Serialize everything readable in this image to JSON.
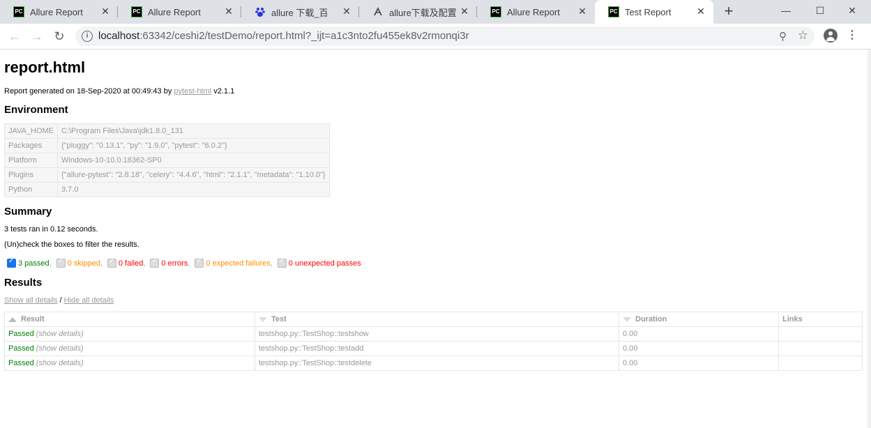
{
  "browser": {
    "tabs": [
      {
        "title": "Allure Report",
        "icon": "pycharm-icon"
      },
      {
        "title": "Allure Report",
        "icon": "pycharm-icon"
      },
      {
        "title": "allure 下载_百度搜索",
        "icon": "baidu-paw-icon"
      },
      {
        "title": "allure下载及配置 -",
        "icon": "refresh-doc-icon"
      },
      {
        "title": "Allure Report",
        "icon": "pycharm-icon"
      },
      {
        "title": "Test Report",
        "icon": "pycharm-icon"
      }
    ],
    "tab_icon_text": "PC",
    "close_glyph": "✕",
    "new_tab_glyph": "+",
    "window": {
      "minimize": "—",
      "maximize": "☐",
      "close": "✕"
    },
    "url_host": "localhost",
    "url_rest": ":63342/ceshi2/testDemo/report.html?_ijt=a1c3nto2fu455ek8v2rmonqi3r",
    "nav": {
      "back": "←",
      "forward": "→",
      "reload": "↻"
    },
    "info_glyph": "i",
    "zoom_glyph": "⚲",
    "star_glyph": "☆",
    "menu_glyph": "⋮"
  },
  "report": {
    "title": "report.html",
    "generated_prefix": "Report generated on 18-Sep-2020 at 00:49:43 by ",
    "generated_link": "pytest-html",
    "generated_suffix": " v2.1.1",
    "environment_heading": "Environment",
    "environment": [
      {
        "key": "JAVA_HOME",
        "value": "C:\\Program Files\\Java\\jdk1.8.0_131"
      },
      {
        "key": "Packages",
        "value": "{\"pluggy\": \"0.13.1\", \"py\": \"1.9.0\", \"pytest\": \"6.0.2\"}"
      },
      {
        "key": "Platform",
        "value": "Windows-10-10.0.18362-SP0"
      },
      {
        "key": "Plugins",
        "value": "{\"allure-pytest\": \"2.8.18\", \"celery\": \"4.4.6\", \"html\": \"2.1.1\", \"metadata\": \"1.10.0\"}"
      },
      {
        "key": "Python",
        "value": "3.7.0"
      }
    ],
    "summary_heading": "Summary",
    "summary_ran": "3 tests ran in 0.12 seconds.",
    "summary_hint": "(Un)check the boxes to filter the results.",
    "filters": [
      {
        "label": "3 passed",
        "sep": ",",
        "checked": true,
        "color": "#008000"
      },
      {
        "label": "0 skipped",
        "sep": ",",
        "checked": true,
        "color": "#ff8c00"
      },
      {
        "label": "0 failed",
        "sep": ",",
        "checked": true,
        "color": "#ff0000"
      },
      {
        "label": "0 errors",
        "sep": ",",
        "checked": true,
        "color": "#ff0000"
      },
      {
        "label": "0 expected failures",
        "sep": ",",
        "checked": true,
        "color": "#ff8c00"
      },
      {
        "label": "0 unexpected passes",
        "sep": "",
        "checked": true,
        "color": "#ff0000"
      }
    ],
    "results_heading": "Results",
    "show_all": "Show all details",
    "divider": " / ",
    "hide_all": "Hide all details",
    "columns": [
      "Result",
      "Test",
      "Duration",
      "Links"
    ],
    "rows": [
      {
        "result": "Passed",
        "details": "(show details)",
        "test": "testshop.py::TestShop::testshow",
        "duration": "0.00",
        "links": ""
      },
      {
        "result": "Passed",
        "details": "(show details)",
        "test": "testshop.py::TestShop::testadd",
        "duration": "0.00",
        "links": ""
      },
      {
        "result": "Passed",
        "details": "(show details)",
        "test": "testshop.py::TestShop::testdelete",
        "duration": "0.00",
        "links": ""
      }
    ]
  }
}
